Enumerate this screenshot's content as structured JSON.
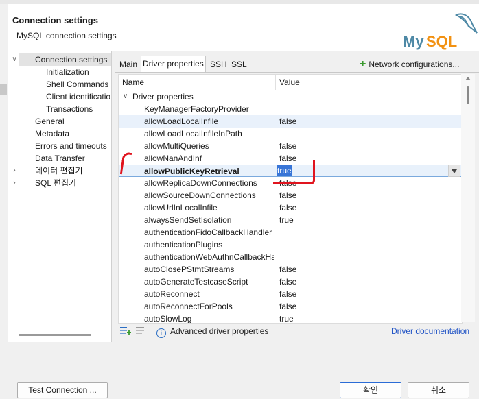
{
  "header": {
    "title": "Connection settings",
    "subtitle": "MySQL connection settings",
    "logo_text": "MySQL"
  },
  "nav": {
    "items": [
      {
        "label": "Connection settings",
        "indent": 1,
        "expanded": true,
        "selected": true
      },
      {
        "label": "Initialization",
        "indent": 2
      },
      {
        "label": "Shell Commands",
        "indent": 2
      },
      {
        "label": "Client identification",
        "indent": 2
      },
      {
        "label": "Transactions",
        "indent": 2
      },
      {
        "label": "General",
        "indent": 1
      },
      {
        "label": "Metadata",
        "indent": 1
      },
      {
        "label": "Errors and timeouts",
        "indent": 1
      },
      {
        "label": "Data Transfer",
        "indent": 1
      },
      {
        "label": "데이터 편집기",
        "indent": 1,
        "collapsed": true
      },
      {
        "label": "SQL 편집기",
        "indent": 1,
        "collapsed": true
      }
    ]
  },
  "tabs": [
    "Main",
    "Driver properties",
    "SSH",
    "SSL"
  ],
  "active_tab": "Driver properties",
  "network_button": "Network configurations...",
  "table": {
    "col_name": "Name",
    "col_value": "Value",
    "group": "Driver properties",
    "rows": [
      {
        "name": "KeyManagerFactoryProvider",
        "value": ""
      },
      {
        "name": "allowLoadLocalInfile",
        "value": "false",
        "alt": true
      },
      {
        "name": "allowLoadLocalInfileInPath",
        "value": ""
      },
      {
        "name": "allowMultiQueries",
        "value": "false"
      },
      {
        "name": "allowNanAndInf",
        "value": "false"
      },
      {
        "name": "allowPublicKeyRetrieval",
        "value": "true",
        "selected": true
      },
      {
        "name": "allowReplicaDownConnections",
        "value": "false"
      },
      {
        "name": "allowSourceDownConnections",
        "value": "false"
      },
      {
        "name": "allowUrlInLocalInfile",
        "value": "false"
      },
      {
        "name": "alwaysSendSetIsolation",
        "value": "true"
      },
      {
        "name": "authenticationFidoCallbackHandler",
        "value": ""
      },
      {
        "name": "authenticationPlugins",
        "value": ""
      },
      {
        "name": "authenticationWebAuthnCallbackHandler",
        "value": ""
      },
      {
        "name": "autoClosePStmtStreams",
        "value": "false"
      },
      {
        "name": "autoGenerateTestcaseScript",
        "value": "false"
      },
      {
        "name": "autoReconnect",
        "value": "false"
      },
      {
        "name": "autoReconnectForPools",
        "value": "false"
      },
      {
        "name": "autoSlowLog",
        "value": "true"
      }
    ]
  },
  "advanced_label": "Advanced driver properties",
  "doc_link": "Driver documentation",
  "footer": {
    "test_button": "Test Connection ...",
    "ok_button": "확인",
    "cancel_button": "취소"
  },
  "colors": {
    "selection": "#3875d7",
    "annotation": "#e0141e",
    "link": "#2456c6",
    "plus": "#3a9a2f"
  }
}
